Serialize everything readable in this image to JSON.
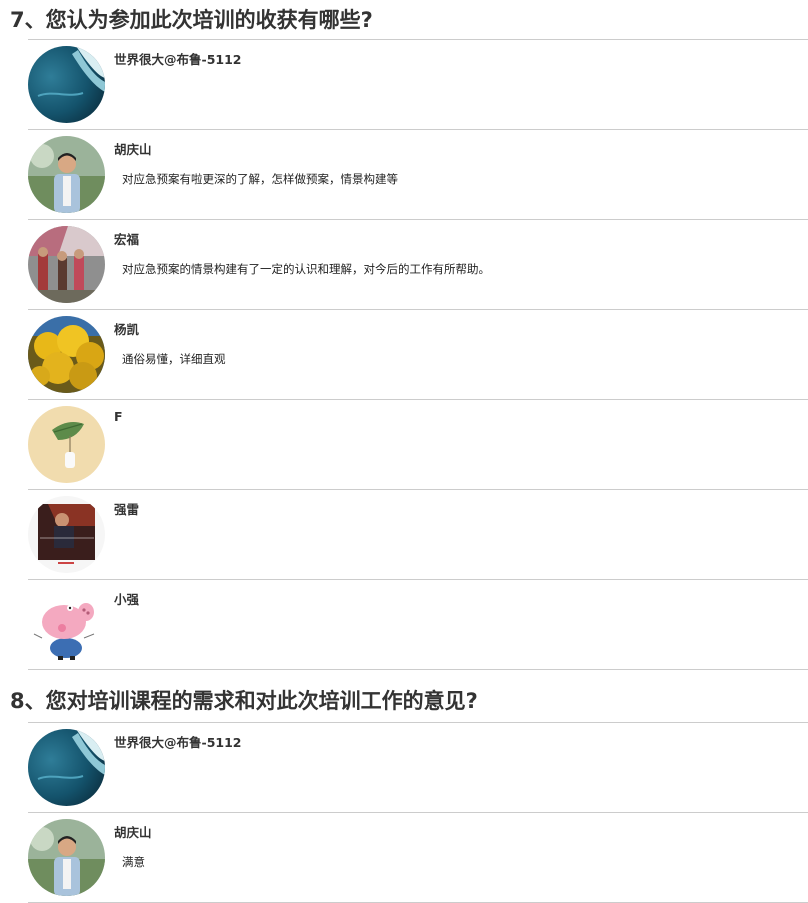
{
  "q7": {
    "title": "7、您认为参加此次培训的收获有哪些?",
    "entries": [
      {
        "name": "世界很大@布鲁-5112",
        "answer": "",
        "avatar": "ocean-wave-avatar"
      },
      {
        "name": "胡庆山",
        "answer": "对应急预案有啦更深的了解，怎样做预案，情景构建等",
        "avatar": "man-in-suit-avatar"
      },
      {
        "name": "宏福",
        "answer": "对应急预案的情景构建有了一定的认识和理解，对今后的工作有所帮助。",
        "avatar": "group-photo-avatar"
      },
      {
        "name": "杨凯",
        "answer": "通俗易懂，详细直观",
        "avatar": "yellow-flowers-avatar"
      },
      {
        "name": "F",
        "answer": "",
        "avatar": "leaf-vase-avatar"
      },
      {
        "name": "强雷",
        "answer": "",
        "avatar": "hello-poster-avatar"
      },
      {
        "name": "小强",
        "answer": "",
        "avatar": "cartoon-pig-avatar"
      }
    ]
  },
  "q8": {
    "title": "8、您对培训课程的需求和对此次培训工作的意见?",
    "entries": [
      {
        "name": "世界很大@布鲁-5112",
        "answer": "",
        "avatar": "ocean-wave-avatar"
      },
      {
        "name": "胡庆山",
        "answer": "满意",
        "avatar": "man-in-suit-avatar"
      }
    ]
  }
}
